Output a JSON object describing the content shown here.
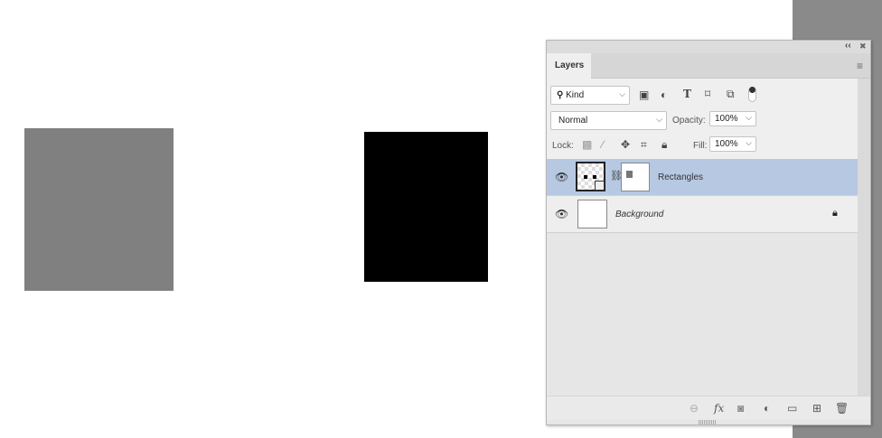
{
  "panel": {
    "collapse_label": "‹‹",
    "close_label": "✖",
    "tab_label": "Layers",
    "filter": {
      "value": "Kind"
    },
    "blend_mode": "Normal",
    "opacity_label": "Opacity:",
    "opacity_value": "100%",
    "lock_label": "Lock:",
    "fill_label": "Fill:",
    "fill_value": "100%",
    "layers": [
      {
        "name": "Rectangles",
        "selected": true,
        "visible": true
      },
      {
        "name": "Background",
        "selected": false,
        "visible": true,
        "locked": true
      }
    ]
  },
  "colors": {
    "selected_row": "#b7c8e2",
    "canvas_gray_rect": "#808080",
    "canvas_black_rect": "#000000"
  }
}
